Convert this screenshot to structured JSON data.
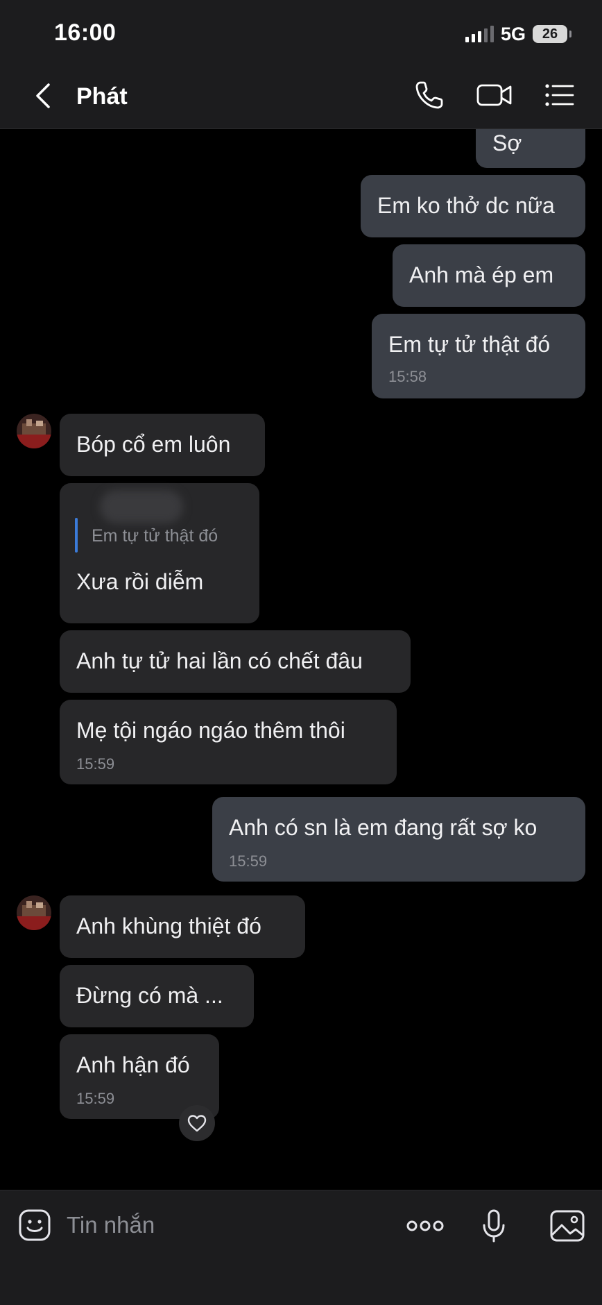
{
  "status_bar": {
    "time": "16:00",
    "network": "5G",
    "battery": "26"
  },
  "header": {
    "contact_name": "Phát",
    "icons": [
      "back-chevron-icon",
      "phone-icon",
      "video-camera-icon",
      "list-menu-icon"
    ]
  },
  "messages": [
    {
      "direction": "out",
      "text": "Sợ"
    },
    {
      "direction": "out",
      "text": "Em ko thở dc nữa"
    },
    {
      "direction": "out",
      "text": "Anh mà ép em"
    },
    {
      "direction": "out",
      "text": "Em tự tử thật đó",
      "time": "15:58"
    },
    {
      "direction": "in",
      "text": "Bóp cổ em luôn"
    },
    {
      "direction": "in",
      "quoted_text": "Em tự tử thật đó",
      "text": "Xưa rồi diễm"
    },
    {
      "direction": "in",
      "text": "Anh tự tử hai lần có chết đâu"
    },
    {
      "direction": "in",
      "text": "Mẹ tội ngáo ngáo thêm thôi",
      "time": "15:59"
    },
    {
      "direction": "out",
      "text": "Anh có sn là em đang rất sợ ko",
      "time": "15:59"
    },
    {
      "direction": "in",
      "text": "Anh khùng thiệt đó"
    },
    {
      "direction": "in",
      "text": "Đừng có mà ..."
    },
    {
      "direction": "in",
      "text": "Anh hận đó",
      "time": "15:59",
      "reaction": "heart-outline-icon"
    }
  ],
  "input_bar": {
    "placeholder": "Tin nhắn",
    "icons": [
      "sticker-face-icon",
      "more-dots-icon",
      "microphone-icon",
      "image-icon"
    ]
  },
  "colors": {
    "background": "#000000",
    "bar_background": "#1c1c1e",
    "outgoing_bubble": "#3b3f47",
    "incoming_bubble": "#272729",
    "timestamp": "#8d8f95",
    "quote_accent": "#3b7bd8"
  }
}
